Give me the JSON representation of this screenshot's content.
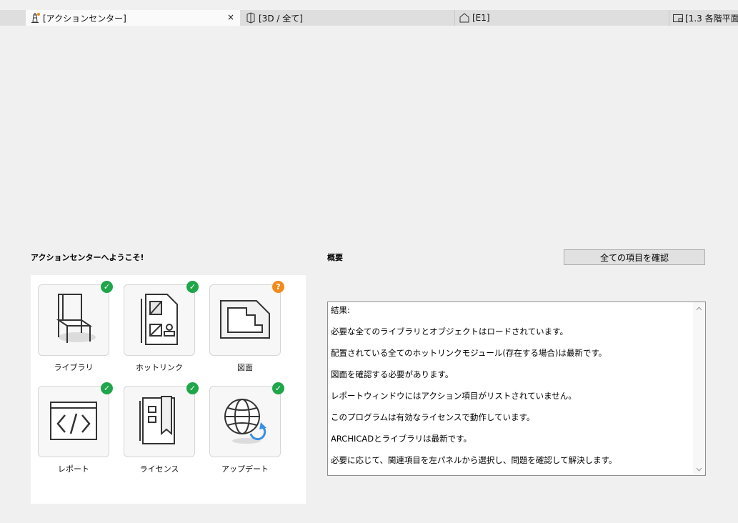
{
  "tabs": [
    {
      "label": "[アクションセンター]",
      "icon": "lighthouse-icon",
      "close": "×"
    },
    {
      "label": "[3D / 全て]",
      "icon": "3d-view-icon"
    },
    {
      "label": "[E1]",
      "icon": "elevation-icon"
    },
    {
      "label": "[1.3 各階平面",
      "icon": "floor-plan-icon"
    }
  ],
  "left": {
    "title": "アクションセンターへようこそ!",
    "tiles": [
      {
        "label": "ライブラリ",
        "icon": "chair-icon",
        "status": "ok"
      },
      {
        "label": "ホットリンク",
        "icon": "hotlink-icon",
        "status": "ok"
      },
      {
        "label": "図面",
        "icon": "drawing-icon",
        "status": "warn",
        "badge_text": "?"
      },
      {
        "label": "レポート",
        "icon": "code-icon",
        "status": "ok"
      },
      {
        "label": "ライセンス",
        "icon": "license-icon",
        "status": "ok"
      },
      {
        "label": "アップデート",
        "icon": "globe-update-icon",
        "status": "ok"
      }
    ]
  },
  "right": {
    "title": "概要",
    "check_all_label": "全ての項目を確認",
    "results": [
      "結果:",
      "必要な全てのライブラリとオブジェクトはロードされています。",
      "配置されている全てのホットリンクモジュール(存在する場合)は最新です。",
      "図面を確認する必要があります。",
      "レポートウィンドウにはアクション項目がリストされていません。",
      "このプログラムは有効なライセンスで動作しています。",
      "ARCHICADとライブラリは最新です。",
      "必要に応じて、関連項目を左パネルから選択し、問題を確認して解決します。"
    ]
  },
  "colors": {
    "ok": "#1fa54a",
    "warn": "#f28a1e",
    "accent": "#3a8fe8"
  }
}
